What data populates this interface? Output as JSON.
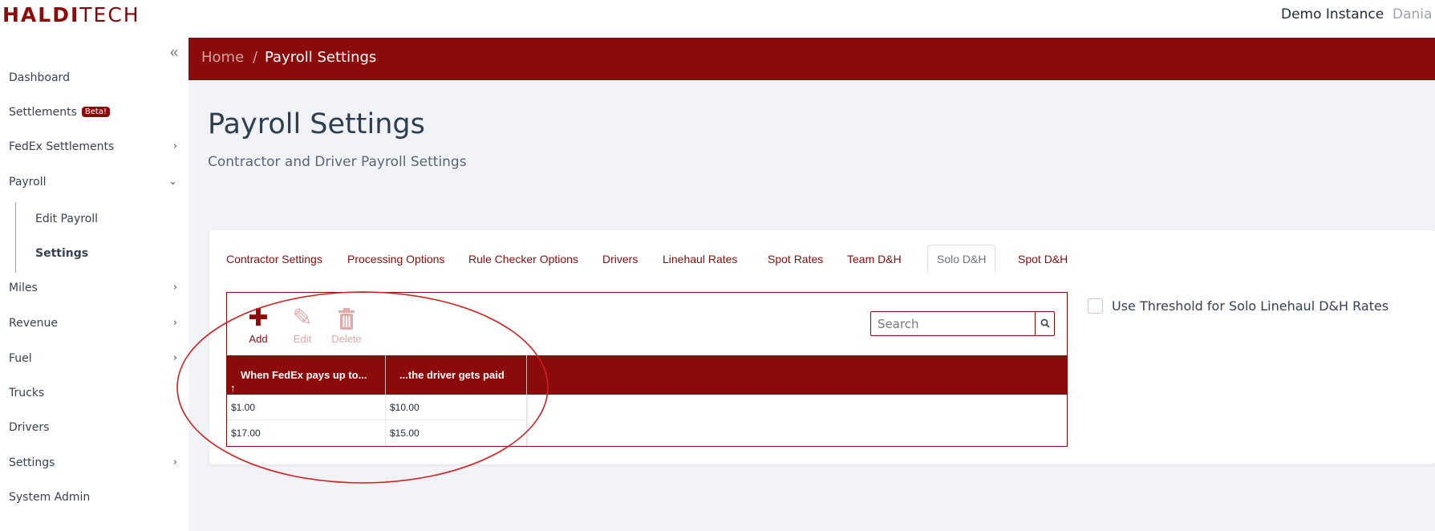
{
  "header": {
    "logo_bold": "HALDI",
    "logo_light": "TECH",
    "instance": "Demo Instance",
    "user": "Dania"
  },
  "sidebar": {
    "collapse_icon": "double-chevron-left-icon",
    "items": [
      {
        "label": "Dashboard"
      },
      {
        "label": "Settlements",
        "badge": "Beta!"
      },
      {
        "label": "FedEx Settlements"
      },
      {
        "label": "Payroll"
      },
      {
        "label": "Miles"
      },
      {
        "label": "Revenue"
      },
      {
        "label": "Fuel"
      },
      {
        "label": "Trucks"
      },
      {
        "label": "Drivers"
      },
      {
        "label": "Settings"
      },
      {
        "label": "System Admin"
      }
    ],
    "payroll_sub": [
      {
        "label": "Edit Payroll"
      },
      {
        "label": "Settings",
        "active": true
      }
    ]
  },
  "breadcrumb": {
    "home": "Home",
    "separator": "/",
    "current": "Payroll Settings"
  },
  "page": {
    "title": "Payroll Settings",
    "subtitle": "Contractor and Driver Payroll Settings"
  },
  "tabs": [
    {
      "label": "Contractor Settings"
    },
    {
      "label": "Processing Options"
    },
    {
      "label": "Rule Checker Options"
    },
    {
      "label": "Drivers"
    },
    {
      "label": "Linehaul Rates"
    },
    {
      "label": "Spot Rates"
    },
    {
      "label": "Team D&H"
    },
    {
      "label": "Solo D&H",
      "active": true
    },
    {
      "label": "Spot D&H"
    }
  ],
  "toolbar": {
    "add_label": "Add",
    "edit_label": "Edit",
    "delete_label": "Delete"
  },
  "search": {
    "placeholder": "Search"
  },
  "table": {
    "columns": [
      "When FedEx pays up to...",
      "...the driver gets paid"
    ],
    "rows": [
      [
        "$1.00",
        "$10.00"
      ],
      [
        "$17.00",
        "$15.00"
      ]
    ]
  },
  "threshold": {
    "label": "Use Threshold for Solo Linehaul D&H Rates",
    "checked": false
  },
  "colors": {
    "brand": "#8b0a0a",
    "background": "#f1f3f7",
    "annotation": "#d11f1f"
  }
}
